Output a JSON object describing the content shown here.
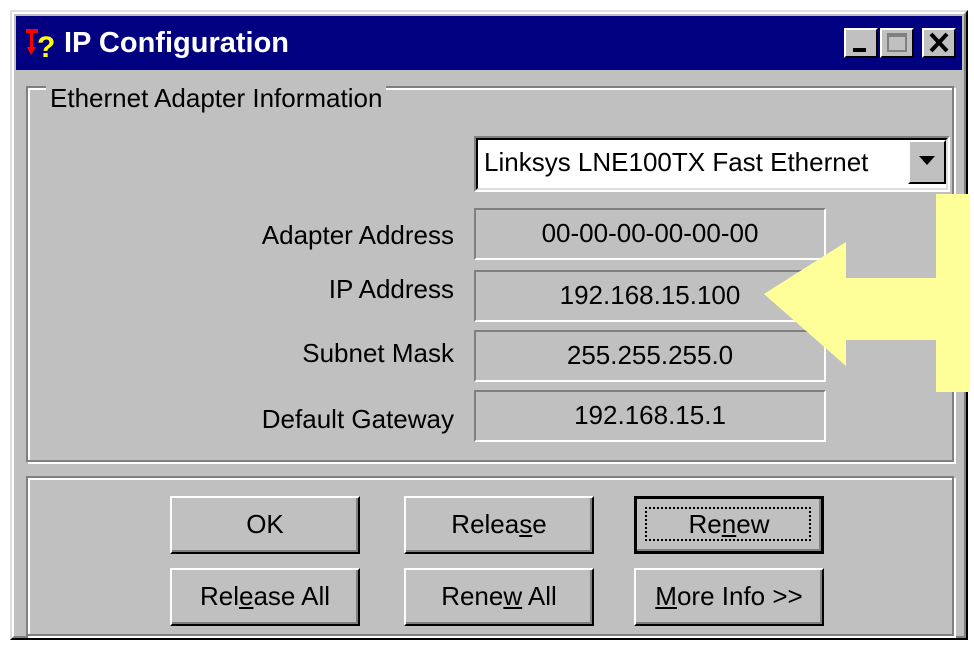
{
  "window": {
    "title": "IP Configuration",
    "controls": {
      "minimize": "minimize-icon",
      "maximize": "maximize-icon",
      "close": "close-icon"
    }
  },
  "group": {
    "label": "Ethernet  Adapter Information"
  },
  "adapter_select": {
    "value": "Linksys LNE100TX Fast Ethernet"
  },
  "fields": [
    {
      "label": "Adapter Address",
      "value": "00-00-00-00-00-00"
    },
    {
      "label": "IP Address",
      "value": "192.168.15.100"
    },
    {
      "label": "Subnet Mask",
      "value": "255.255.255.0"
    },
    {
      "label": "Default Gateway",
      "value": "192.168.15.1"
    }
  ],
  "buttons": {
    "ok": "OK",
    "release": {
      "pre": "Relea",
      "key": "s",
      "post": "e"
    },
    "renew": {
      "pre": "Re",
      "key": "n",
      "post": "ew"
    },
    "release_all": {
      "pre": "Rel",
      "key": "e",
      "post": "ase All"
    },
    "renew_all": {
      "pre": "Rene",
      "key": "w",
      "post": " All"
    },
    "more_info": {
      "pre": "",
      "key": "M",
      "post": "ore Info >>"
    }
  },
  "annotation": {
    "arrow_color": "#ffff99",
    "icon": "pointer-arrow-icon"
  },
  "colors": {
    "titlebar": "#000080",
    "face": "#c0c0c0"
  }
}
